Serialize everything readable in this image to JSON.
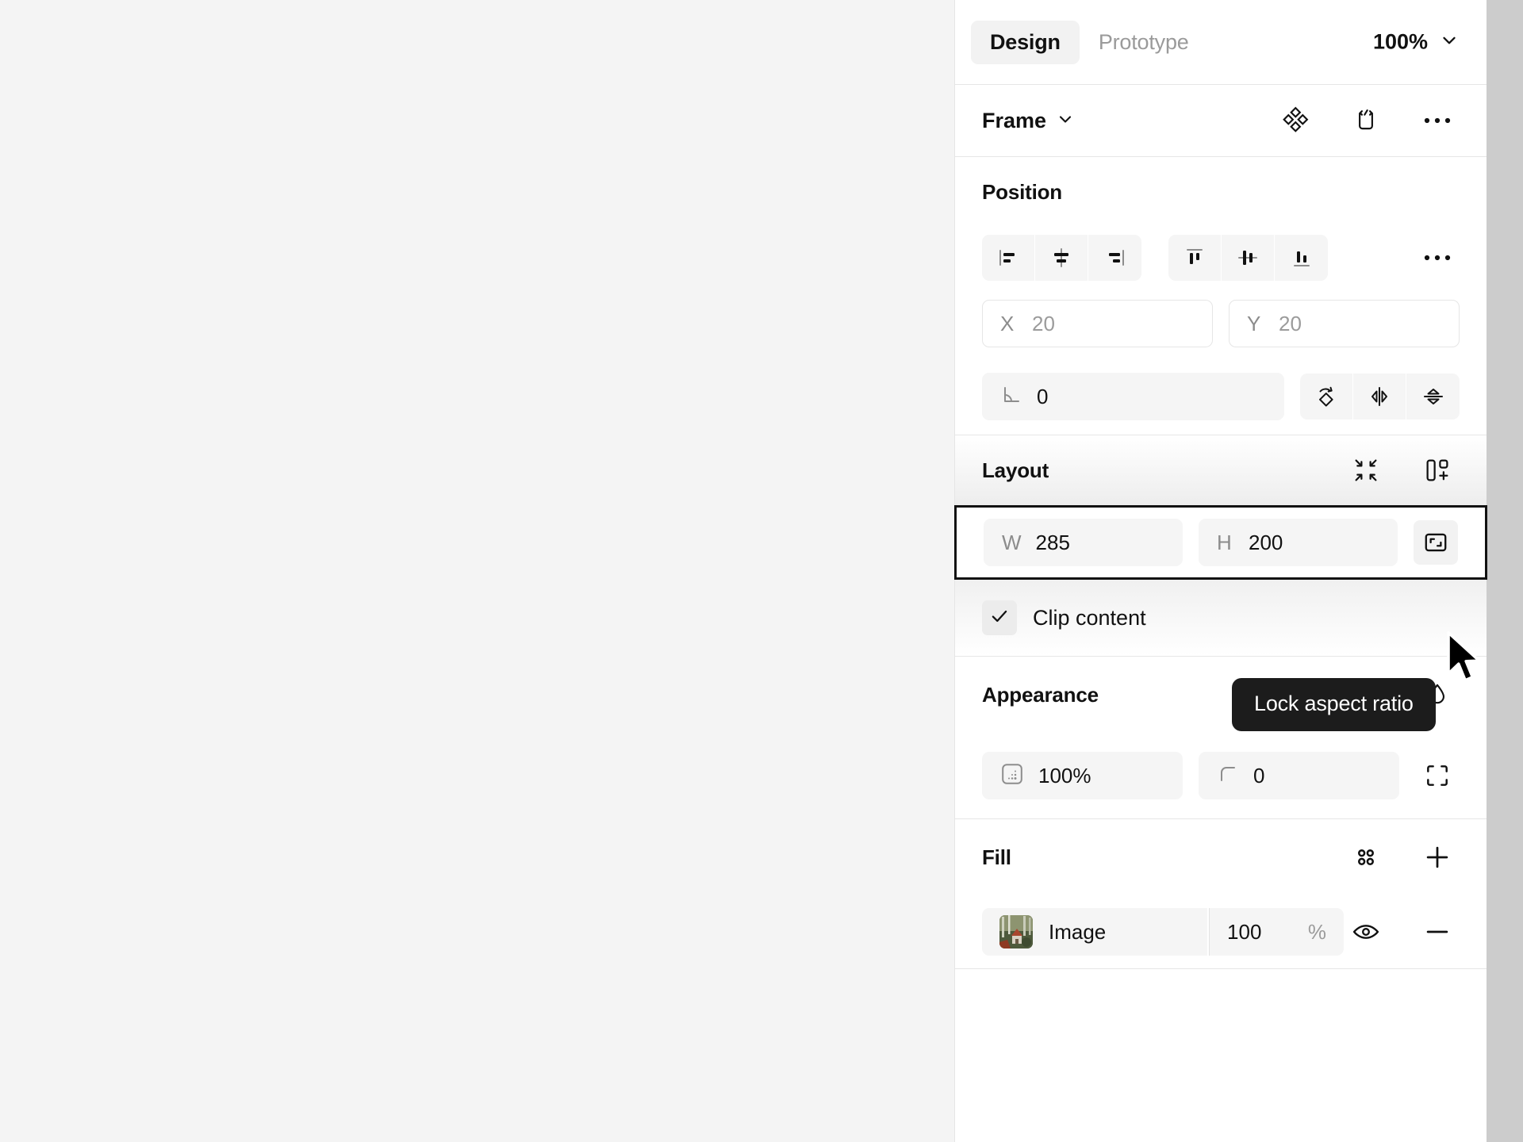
{
  "header": {
    "tabs": [
      {
        "label": "Design",
        "active": true
      },
      {
        "label": "Prototype",
        "active": false
      }
    ],
    "zoom": "100%",
    "zoom_chevron_icon": "chevron-down-icon"
  },
  "object": {
    "type_label": "Frame",
    "type_chevron_icon": "chevron-down-icon",
    "actions": [
      {
        "icon": "component-icon"
      },
      {
        "icon": "dev-mode-code-icon"
      },
      {
        "icon": "more-options-icon"
      }
    ]
  },
  "position": {
    "title": "Position",
    "align_horizontal": [
      {
        "icon": "align-left-icon"
      },
      {
        "icon": "align-horizontal-center-icon"
      },
      {
        "icon": "align-right-icon"
      }
    ],
    "align_vertical": [
      {
        "icon": "align-top-icon"
      },
      {
        "icon": "align-vertical-center-icon"
      },
      {
        "icon": "align-bottom-icon"
      }
    ],
    "more_icon": "more-align-options-icon",
    "x": {
      "key": "X",
      "value": "20"
    },
    "y": {
      "key": "Y",
      "value": "20"
    },
    "rotation": {
      "icon": "angle-icon",
      "value": "0"
    },
    "transforms": [
      {
        "icon": "rotate-90-icon"
      },
      {
        "icon": "flip-horizontal-icon"
      },
      {
        "icon": "flip-vertical-icon"
      }
    ]
  },
  "layout": {
    "title": "Layout",
    "head_icons": [
      {
        "icon": "resize-to-fit-icon"
      },
      {
        "icon": "add-auto-layout-icon"
      }
    ],
    "width": {
      "key": "W",
      "value": "285"
    },
    "height": {
      "key": "H",
      "value": "200"
    },
    "lock_aspect_ratio_icon": "lock-aspect-ratio-icon",
    "clip_content": {
      "label": "Clip content",
      "checked": true,
      "check_icon": "check-icon"
    }
  },
  "appearance": {
    "title": "Appearance",
    "head_icons": [
      {
        "icon": "blend-mode-icon"
      },
      {
        "icon": "visibility-eye-icon"
      },
      {
        "icon": "drop-color-icon"
      }
    ],
    "opacity": {
      "icon": "opacity-icon",
      "value": "100%"
    },
    "corner_radius": {
      "icon": "corner-radius-icon",
      "value": "0"
    },
    "independent_corners_icon": "independent-corners-icon"
  },
  "fill": {
    "title": "Fill",
    "head_icons": [
      {
        "icon": "fill-styles-grid-icon"
      },
      {
        "icon": "add-fill-plus-icon"
      }
    ],
    "items": [
      {
        "swatch_icon": "image-thumbnail",
        "name": "Image",
        "opacity_value": "100",
        "opacity_unit": "%",
        "visibility_icon": "visibility-eye-icon",
        "remove_icon": "remove-minus-icon"
      }
    ]
  },
  "tooltip": {
    "text": "Lock aspect ratio"
  },
  "cursor": {
    "icon": "mouse-pointer-icon"
  },
  "colors": {
    "canvas": "#f4f4f4",
    "panel": "#ffffff",
    "field": "#f5f5f5",
    "text": "#111111",
    "muted": "#9b9b9b",
    "tooltip_bg": "#1c1c1c",
    "selection_outline": "#111111"
  }
}
